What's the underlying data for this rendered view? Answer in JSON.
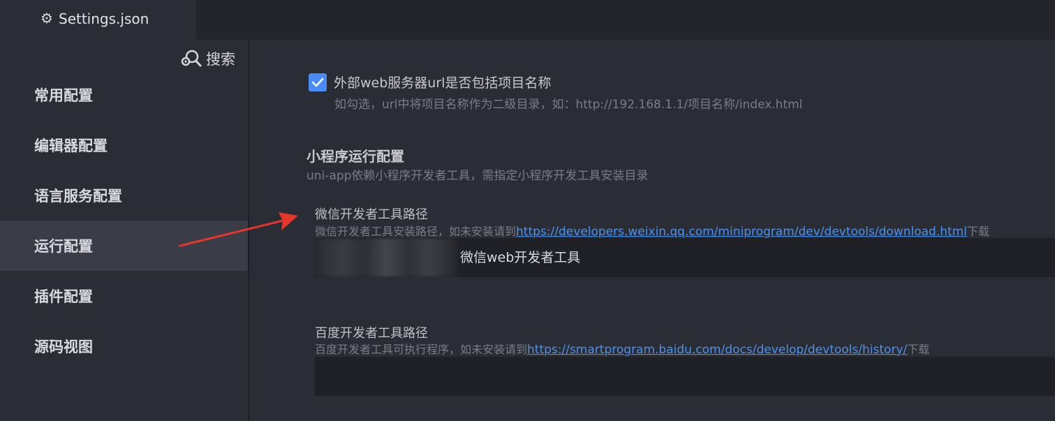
{
  "tab": {
    "icon": "gear-icon",
    "label": "Settings.json"
  },
  "sidebar": {
    "search_icon": "search-gear-icon",
    "search_label": "搜索",
    "items": [
      {
        "label": "常用配置",
        "active": false
      },
      {
        "label": "编辑器配置",
        "active": false
      },
      {
        "label": "语言服务配置",
        "active": false
      },
      {
        "label": "运行配置",
        "active": true
      },
      {
        "label": "插件配置",
        "active": false
      },
      {
        "label": "源码视图",
        "active": false
      }
    ]
  },
  "main": {
    "url_option": {
      "checked": true,
      "title": "外部web服务器url是否包括项目名称",
      "description": "如勾选，url中将项目名称作为二级目录，如：http://192.168.1.1/项目名称/index.html"
    },
    "section": {
      "title": "小程序运行配置",
      "description": "uni-app依赖小程序开发者工具，需指定小程序开发工具安装目录"
    },
    "wechat": {
      "label": "微信开发者工具路径",
      "desc_prefix": "微信开发者工具安装路径，如未安装请到",
      "link": "https://developers.weixin.qq.com/miniprogram/dev/devtools/download.html",
      "desc_suffix": "下载",
      "value": "微信web开发者工具"
    },
    "baidu": {
      "label": "百度开发者工具路径",
      "desc_prefix": "百度开发者工具可执行程序，如未安装请到",
      "link": "https://smartprogram.baidu.com/docs/develop/devtools/history/",
      "desc_suffix": "下载",
      "value": ""
    }
  },
  "colors": {
    "accent": "#4a8cf7",
    "link": "#4a92f0",
    "annotation_arrow": "#e8352b"
  }
}
